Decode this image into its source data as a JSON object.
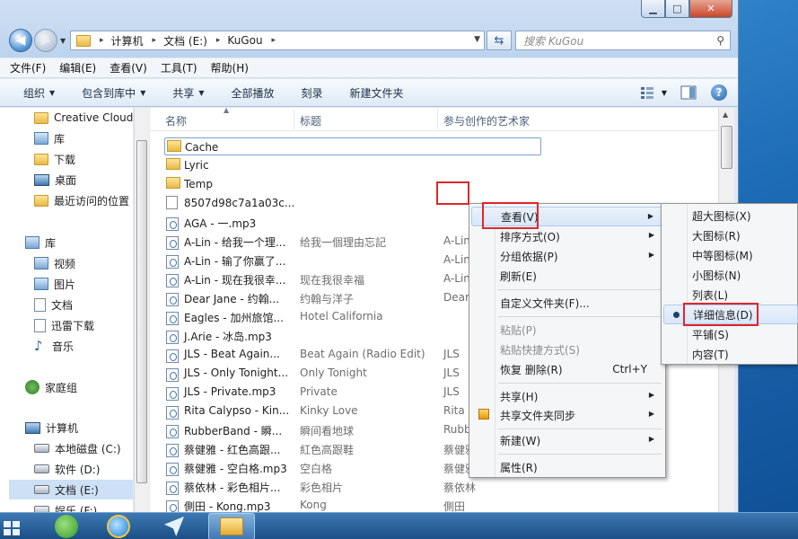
{
  "window": {
    "controls": {
      "minimize": "▁",
      "maximize": "□",
      "close": "✕"
    }
  },
  "address": {
    "segments": [
      "计算机",
      "文档 (E:)",
      "KuGou"
    ],
    "separator": "▸"
  },
  "search": {
    "placeholder": "搜索 KuGou"
  },
  "menubar": [
    "文件(F)",
    "编辑(E)",
    "查看(V)",
    "工具(T)",
    "帮助(H)"
  ],
  "toolbar": {
    "organize": "组织",
    "include_in_library": "包含到库中",
    "share": "共享",
    "play_all": "全部播放",
    "burn": "刻录",
    "new_folder": "新建文件夹"
  },
  "nav_pane": {
    "items": [
      {
        "label": "Creative Cloud",
        "icon": "folder-icon"
      },
      {
        "label": "库",
        "icon": "library-icon"
      },
      {
        "label": "下载",
        "icon": "folder-icon"
      },
      {
        "label": "桌面",
        "icon": "desktop-icon"
      },
      {
        "label": "最近访问的位置",
        "icon": "folder-icon"
      },
      {
        "label": "库",
        "icon": "library-icon"
      },
      {
        "label": "视频",
        "icon": "library-icon"
      },
      {
        "label": "图片",
        "icon": "library-icon"
      },
      {
        "label": "文档",
        "icon": "document-icon"
      },
      {
        "label": "迅雷下载",
        "icon": "document-icon"
      },
      {
        "label": "音乐",
        "icon": "music-icon"
      },
      {
        "label": "家庭组",
        "icon": "homegroup-icon"
      },
      {
        "label": "计算机",
        "icon": "computer-icon"
      },
      {
        "label": "本地磁盘 (C:)",
        "icon": "drive-icon"
      },
      {
        "label": "软件 (D:)",
        "icon": "drive-icon"
      },
      {
        "label": "文档 (E:)",
        "icon": "drive-icon"
      },
      {
        "label": "娱乐 (F:)",
        "icon": "drive-icon"
      }
    ]
  },
  "columns": {
    "name": "名称",
    "title": "标题",
    "artist": "参与创作的艺术家"
  },
  "files": [
    {
      "name": "Cache",
      "title": "",
      "artist": "",
      "type": "folder"
    },
    {
      "name": "Lyric",
      "title": "",
      "artist": "",
      "type": "folder"
    },
    {
      "name": "Temp",
      "title": "",
      "artist": "",
      "type": "folder"
    },
    {
      "name": "8507d98c7a1a03c...",
      "title": "",
      "artist": "",
      "type": "file"
    },
    {
      "name": "AGA - 一.mp3",
      "title": "",
      "artist": "",
      "type": "mp3"
    },
    {
      "name": "A-Lin - 给我一个理...",
      "title": "给我一個理由忘記",
      "artist": "A-Lin",
      "type": "mp3"
    },
    {
      "name": "A-Lin - 输了你赢了...",
      "title": "",
      "artist": "A-Lin",
      "type": "mp3"
    },
    {
      "name": "A-Lin - 现在我很幸...",
      "title": "现在我很幸福",
      "artist": "A-Lin",
      "type": "mp3"
    },
    {
      "name": "Dear Jane - 约翰...",
      "title": "约翰与洋子",
      "artist": "Dear",
      "type": "mp3"
    },
    {
      "name": "Eagles - 加州旅馆...",
      "title": "Hotel California",
      "artist": "",
      "type": "mp3"
    },
    {
      "name": "J.Arie - 冰岛.mp3",
      "title": "",
      "artist": "",
      "type": "mp3"
    },
    {
      "name": "JLS - Beat Again...",
      "title": "Beat Again (Radio Edit)",
      "artist": "JLS",
      "type": "mp3"
    },
    {
      "name": "JLS - Only Tonight...",
      "title": "Only Tonight",
      "artist": "JLS",
      "type": "mp3"
    },
    {
      "name": "JLS - Private.mp3",
      "title": "Private",
      "artist": "JLS",
      "type": "mp3"
    },
    {
      "name": "Rita Calypso - Kin...",
      "title": "Kinky Love",
      "artist": "Rita",
      "type": "mp3"
    },
    {
      "name": "RubberBand - 瞬...",
      "title": "瞬间看地球",
      "artist": "Rubb",
      "type": "mp3"
    },
    {
      "name": "蔡健雅 - 红色高跟...",
      "title": "紅色高跟鞋",
      "artist": "蔡健雅",
      "type": "mp3"
    },
    {
      "name": "蔡健雅 - 空白格.mp3",
      "title": "空白格",
      "artist": "蔡健雅",
      "type": "mp3"
    },
    {
      "name": "蔡依林 - 彩色相片...",
      "title": "彩色相片",
      "artist": "蔡依林",
      "type": "mp3"
    },
    {
      "name": "側田 - Kong.mp3",
      "title": "Kong",
      "artist": "側田",
      "type": "mp3"
    }
  ],
  "context_menu": {
    "items": [
      {
        "label": "查看(V)",
        "submenu": true,
        "highlighted": true
      },
      {
        "label": "排序方式(O)",
        "submenu": true
      },
      {
        "label": "分组依据(P)",
        "submenu": true
      },
      {
        "label": "刷新(E)"
      },
      {
        "label": "自定义文件夹(F)..."
      },
      {
        "label": "粘贴(P)",
        "disabled": true
      },
      {
        "label": "粘贴快捷方式(S)",
        "disabled": true
      },
      {
        "label": "恢复 删除(R)",
        "shortcut": "Ctrl+Y"
      },
      {
        "label": "共享(H)",
        "submenu": true
      },
      {
        "label": "共享文件夹同步",
        "submenu": true
      },
      {
        "label": "新建(W)",
        "submenu": true
      },
      {
        "label": "属性(R)"
      }
    ]
  },
  "view_submenu": {
    "items": [
      {
        "label": "超大图标(X)"
      },
      {
        "label": "大图标(R)"
      },
      {
        "label": "中等图标(M)"
      },
      {
        "label": "小图标(N)"
      },
      {
        "label": "列表(L)"
      },
      {
        "label": "详细信息(D)",
        "selected": true
      },
      {
        "label": "平铺(S)"
      },
      {
        "label": "内容(T)"
      }
    ]
  },
  "colors": {
    "annotation": "#e0262b",
    "accent": "#1f5fa8"
  }
}
